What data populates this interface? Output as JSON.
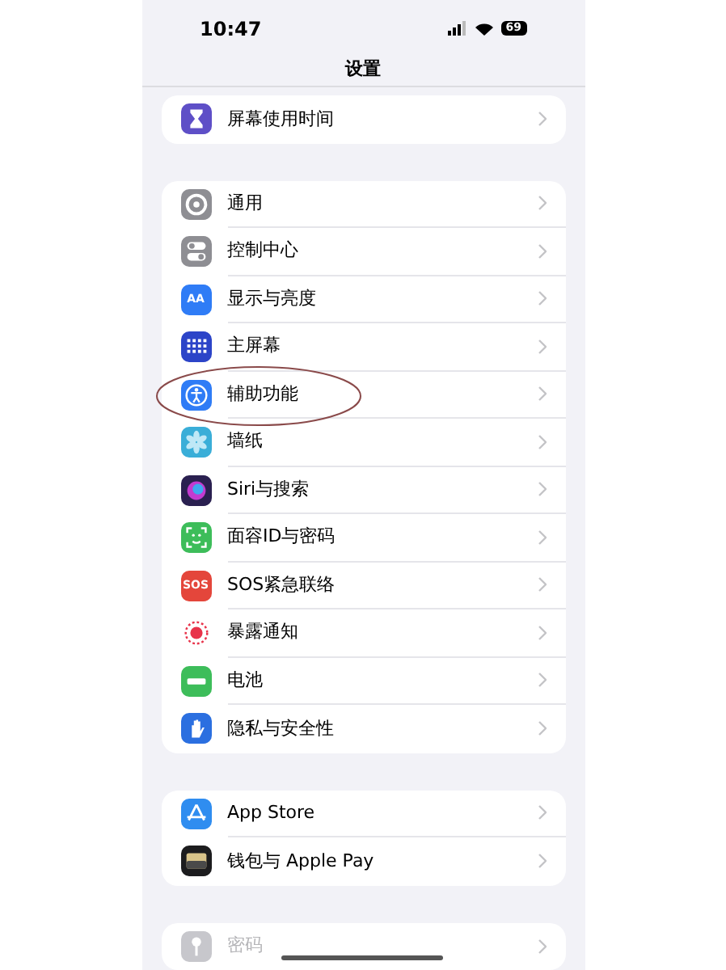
{
  "status_bar": {
    "time": "10:47",
    "battery": "69"
  },
  "title": "设置",
  "groups": [
    {
      "rows": [
        {
          "label": "屏幕使用时间",
          "icon": {
            "kind": "hourglass",
            "color": "#5e4fc7"
          }
        }
      ]
    },
    {
      "rows": [
        {
          "label": "通用",
          "icon": {
            "kind": "gear",
            "color": "#8e8e93"
          }
        },
        {
          "label": "控制中心",
          "icon": {
            "kind": "toggles",
            "color": "#8e8e93"
          }
        },
        {
          "label": "显示与亮度",
          "icon": {
            "kind": "glyph",
            "color": "#2f7cf6",
            "glyph": "AA"
          }
        },
        {
          "label": "主屏幕",
          "icon": {
            "kind": "grid",
            "color": "#2c44c8"
          }
        },
        {
          "label": "辅助功能",
          "icon": {
            "kind": "accessibility",
            "color": "#2f7cf6"
          },
          "circled": true
        },
        {
          "label": "墙纸",
          "icon": {
            "kind": "flower",
            "color": "#3aaed8"
          }
        },
        {
          "label": "Siri与搜索",
          "icon": {
            "kind": "orb",
            "color": "#2a2050"
          }
        },
        {
          "label": "面容ID与密码",
          "icon": {
            "kind": "face",
            "color": "#3dbd5a"
          }
        },
        {
          "label": "SOS紧急联络",
          "icon": {
            "kind": "glyph",
            "color": "#e4463b",
            "glyph": "SOS"
          }
        },
        {
          "label": "暴露通知",
          "icon": {
            "kind": "exposure",
            "color": "#ffffff"
          }
        },
        {
          "label": "电池",
          "icon": {
            "kind": "battery",
            "color": "#3dbd5a"
          }
        },
        {
          "label": "隐私与安全性",
          "icon": {
            "kind": "hand",
            "color": "#2b6fe0"
          }
        }
      ]
    },
    {
      "rows": [
        {
          "label": "App Store",
          "icon": {
            "kind": "appstore",
            "color": "#2f8df0"
          }
        },
        {
          "label": "钱包与 Apple Pay",
          "icon": {
            "kind": "wallet",
            "color": "#1c1c1e"
          }
        }
      ]
    },
    {
      "rows": [
        {
          "label": "密码",
          "icon": {
            "kind": "key",
            "color": "#c7c7cc"
          },
          "dimmed": true
        }
      ]
    }
  ]
}
